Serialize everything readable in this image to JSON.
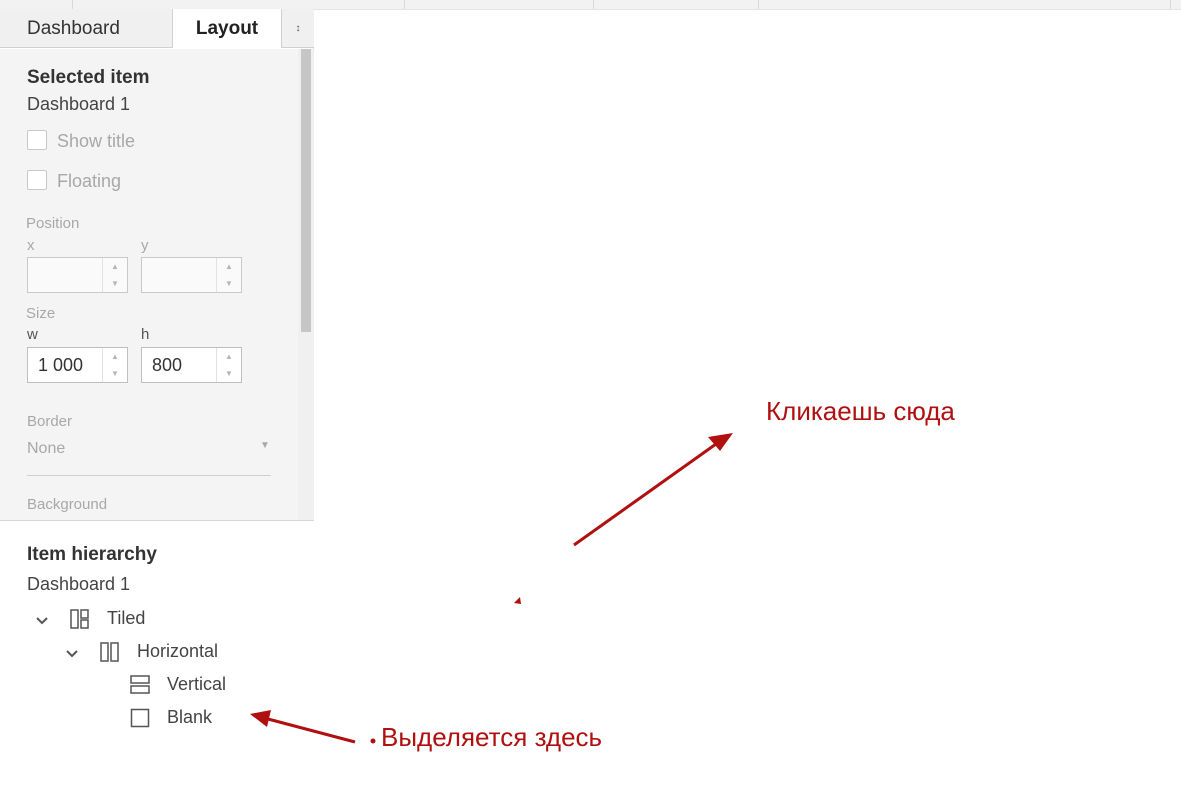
{
  "tabs": {
    "dashboard": "Dashboard",
    "layout": "Layout",
    "menu_icon": "↕"
  },
  "selected_item": {
    "heading": "Selected item",
    "name": "Dashboard 1",
    "show_title": "Show title",
    "floating": "Floating"
  },
  "position": {
    "label": "Position",
    "x_label": "x",
    "y_label": "y",
    "x_value": "",
    "y_value": ""
  },
  "size": {
    "label": "Size",
    "w_label": "w",
    "h_label": "h",
    "w_value": "1 000",
    "h_value": "800"
  },
  "border": {
    "label": "Border",
    "value": "None"
  },
  "background": {
    "label": "Background"
  },
  "hierarchy": {
    "heading": "Item hierarchy",
    "root": "Dashboard 1",
    "items": [
      {
        "label": "Tiled",
        "icon": "tiled-container-icon",
        "expander": "chevron-down-icon"
      },
      {
        "label": "Horizontal",
        "icon": "horizontal-container-icon",
        "expander": "chevron-down-icon"
      },
      {
        "label": "Vertical",
        "icon": "vertical-container-icon"
      },
      {
        "label": "Blank",
        "icon": "blank-object-icon"
      }
    ]
  },
  "annotations": {
    "click_here": "Кликаешь сюда",
    "selected_here": "Выделяется здесь",
    "color": "#b01010"
  }
}
